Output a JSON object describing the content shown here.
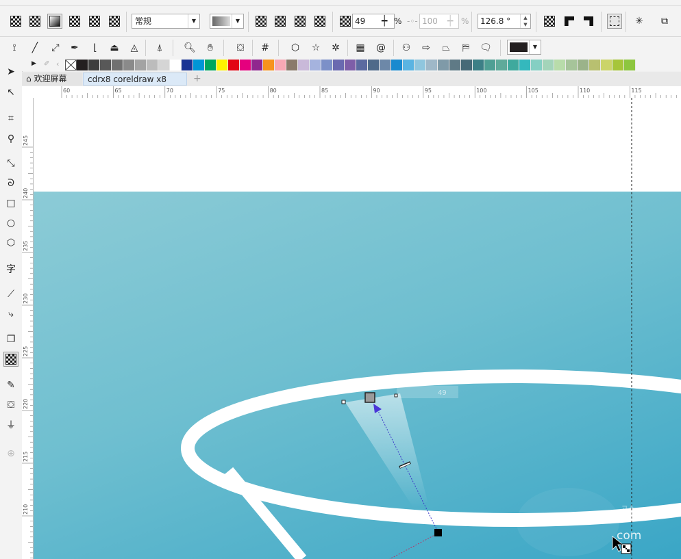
{
  "property_bar": {
    "merge_mode": "常规",
    "transparency_value": "49",
    "transparency_unit": "%",
    "disabled_value": "100",
    "disabled_unit": "%",
    "angle_value": "126.8 °"
  },
  "tabs": [
    {
      "label": "欢迎屏幕"
    },
    {
      "label": "cdrx8 coreldraw x8 教..."
    }
  ],
  "rulers": {
    "top_labels": [
      "60",
      "65",
      "70",
      "75",
      "80",
      "85",
      "90",
      "95",
      "100",
      "105",
      "110",
      "115"
    ],
    "left_labels": [
      "245",
      "240",
      "235",
      "230",
      "225",
      "220",
      "215",
      "210"
    ]
  },
  "canvas": {
    "interactive_label": "49",
    "watermark_text": "com",
    "watermark_glyph": "验"
  },
  "palette": [
    "#231f20",
    "#3d3d3d",
    "#585858",
    "#707070",
    "#8a8a8a",
    "#a3a3a3",
    "#bcbcbc",
    "#d5d5d5",
    "#ffffff",
    "#1a3494",
    "#0096d6",
    "#00a65d",
    "#fff200",
    "#e20613",
    "#e5007e",
    "#90278e",
    "#f7931d",
    "#f7a8b4",
    "#8a7a6b",
    "#c9b9d9",
    "#a5b3de",
    "#7c90c8",
    "#6a69b0",
    "#7e5ea8",
    "#5b6aa0",
    "#4f6a8a",
    "#6d88a8",
    "#1a8acf",
    "#5ab4e2",
    "#8fc6de",
    "#9fb8c8",
    "#7f9aa8",
    "#5f7a86",
    "#466977",
    "#3c7f86",
    "#4f9f94",
    "#5faa9a",
    "#3fa99d",
    "#34b8bd",
    "#85cfc3",
    "#a3d4b9",
    "#b8dcaa",
    "#a6c49a",
    "#9bb38a",
    "#b8c070",
    "#cbd469",
    "#a6c53a",
    "#8dc63f"
  ]
}
